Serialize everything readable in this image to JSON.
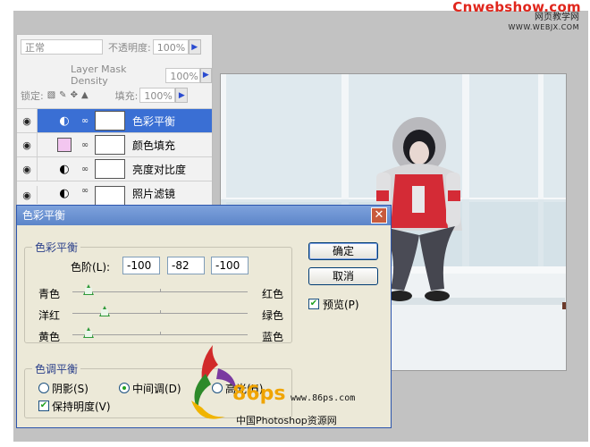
{
  "watermark": {
    "site": "Cnwebshow.com",
    "sub1": "网页教学网",
    "sub2": "WWW.WEBJX.COM"
  },
  "layers_panel": {
    "blend_mode": "正常",
    "opacity_label": "不透明度:",
    "opacity_value": "100%",
    "mask_density_label": "Layer Mask Density",
    "mask_density_value": "100%",
    "lock_label": "锁定:",
    "fill_label": "填充:",
    "fill_value": "100%",
    "layers": [
      {
        "name": "色彩平衡",
        "selected": true
      },
      {
        "name": "颜色填充",
        "selected": false
      },
      {
        "name": "亮度对比度",
        "selected": false
      },
      {
        "name": "照片滤镜",
        "selected": false
      }
    ]
  },
  "dialog": {
    "title": "色彩平衡",
    "color_balance_group": "色彩平衡",
    "levels_label": "色阶(L):",
    "levels": [
      "-100",
      "-82",
      "-100"
    ],
    "sliders": [
      {
        "left": "青色",
        "right": "红色",
        "value": -100
      },
      {
        "left": "洋红",
        "right": "绿色",
        "value": -82
      },
      {
        "left": "黄色",
        "right": "蓝色",
        "value": -100
      }
    ],
    "tone_group": "色调平衡",
    "tones": [
      {
        "label": "阴影(S)",
        "checked": false
      },
      {
        "label": "中间调(D)",
        "checked": true
      },
      {
        "label": "高光(H)",
        "checked": false
      }
    ],
    "preserve_luminosity": "保持明度(V)",
    "ok": "确定",
    "cancel": "取消",
    "preview": "预览(P)"
  },
  "logo": {
    "number": "86ps",
    "url": "www.86ps.com",
    "caption": "中国Photoshop资源网"
  },
  "colors": {
    "accent": "#3a6fd4",
    "title_bar": "#6a8fd0",
    "thumb": "#2f9a3a"
  }
}
